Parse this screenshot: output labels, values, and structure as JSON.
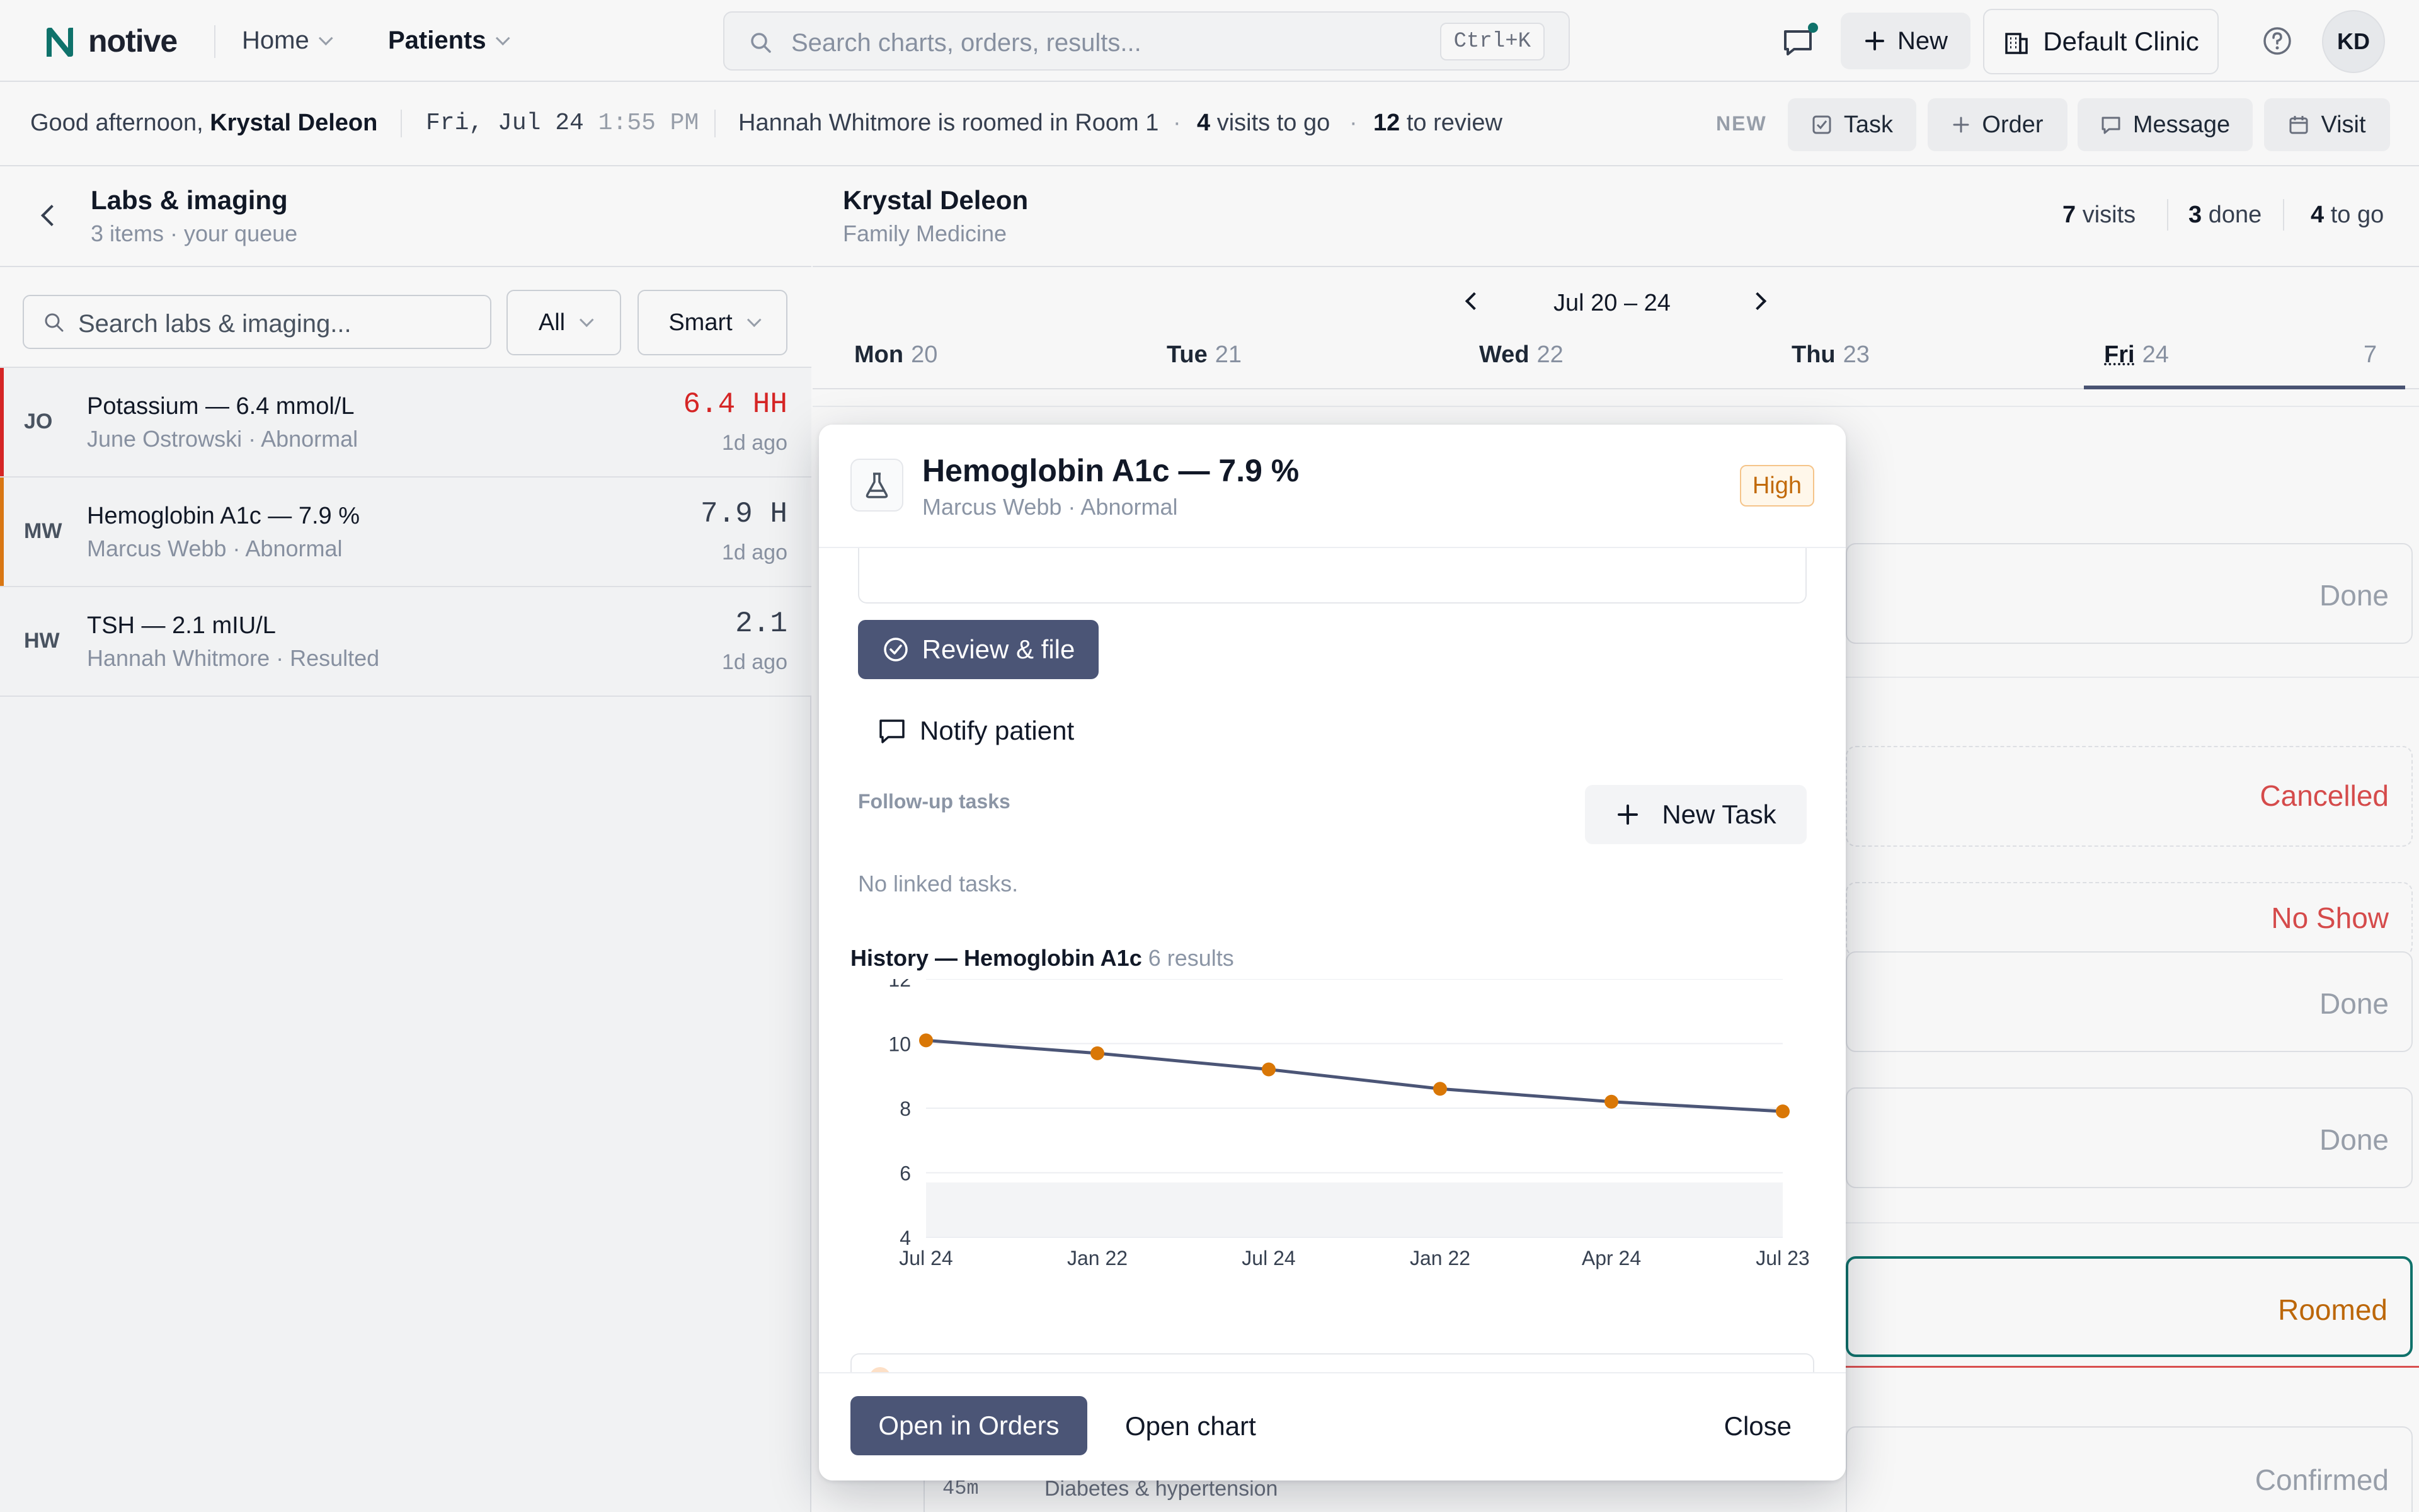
{
  "app": {
    "name": "notive",
    "nav": [
      {
        "label": "Home"
      },
      {
        "label": "Patients"
      }
    ],
    "search": {
      "placeholder": "Search charts, orders, results...",
      "shortcut": "Ctrl+K"
    },
    "new_label": "New",
    "clinic_label": "Default Clinic",
    "user_initials": "KD"
  },
  "status": {
    "greeting": "Good afternoon,",
    "user_name": "Krystal Deleon",
    "date": "Fri, Jul 24",
    "time": "1:55 PM",
    "roomed": "Hannah Whitmore is roomed in Room 1",
    "visits_count": "4",
    "visits_text": "visits to go",
    "review_count": "12",
    "review_text": "to review",
    "new_label": "NEW",
    "actions": [
      {
        "label": "Task",
        "icon": "task-icon"
      },
      {
        "label": "Order",
        "icon": "plus-icon"
      },
      {
        "label": "Message",
        "icon": "message-icon"
      },
      {
        "label": "Visit",
        "icon": "calendar-icon"
      }
    ]
  },
  "left_panel": {
    "title": "Labs & imaging",
    "subtitle": "3 items · your queue",
    "search_placeholder": "Search labs & imaging...",
    "filter_all": "All",
    "filter_smart": "Smart",
    "items": [
      {
        "initials": "JO",
        "name": "Potassium — 6.4 mmol/L",
        "sub": "June Ostrowski · Abnormal",
        "value": "6.4 HH",
        "ago": "1d ago",
        "flag_color": "#dc2626",
        "value_color": "#dc2626"
      },
      {
        "initials": "MW",
        "name": "Hemoglobin A1c — 7.9 %",
        "sub": "Marcus Webb · Abnormal",
        "value": "7.9 H",
        "ago": "1d ago",
        "flag_color": "#e07b13",
        "value_color": "#374151"
      },
      {
        "initials": "HW",
        "name": "TSH — 2.1 mIU/L",
        "sub": "Hannah Whitmore · Resulted",
        "value": "2.1",
        "ago": "1d ago",
        "flag_color": "transparent",
        "value_color": "#374151"
      }
    ]
  },
  "main": {
    "provider_name": "Krystal Deleon",
    "specialty": "Family Medicine",
    "stats": [
      {
        "num": "7",
        "label": "visits"
      },
      {
        "num": "3",
        "label": "done"
      },
      {
        "num": "4",
        "label": "to go"
      }
    ],
    "week_range": "Jul 20 – 24",
    "days": [
      {
        "name": "Mon",
        "num": "20"
      },
      {
        "name": "Tue",
        "num": "21"
      },
      {
        "name": "Wed",
        "num": "22"
      },
      {
        "name": "Thu",
        "num": "23"
      },
      {
        "name": "Fri",
        "num": "24"
      }
    ],
    "fri_count": "7",
    "visit_statuses": [
      {
        "label": "Done",
        "color": "#9ca3af"
      },
      {
        "label": "Cancelled",
        "color": "#dc4d4d"
      },
      {
        "label": "No Show",
        "color": "#dc4d4d"
      },
      {
        "label": "Done",
        "color": "#9ca3af"
      },
      {
        "label": "Done",
        "color": "#9ca3af"
      },
      {
        "label": "Roomed",
        "color": "#c26a0a"
      },
      {
        "label": "Confirmed",
        "color": "#9ca3af"
      }
    ],
    "visit_duration": "45m",
    "visit_reason": "Diabetes & hypertension"
  },
  "modal": {
    "title": "Hemoglobin A1c — 7.9 %",
    "subtitle": "Marcus Webb · Abnormal",
    "badge": "High",
    "review_label": "Review & file",
    "notify_label": "Notify patient",
    "followup_label": "Follow-up tasks",
    "new_task_label": "New Task",
    "no_linked": "No linked tasks.",
    "history_title": "History — Hemoglobin A1c",
    "history_count": "6 results",
    "open_orders_label": "Open in Orders",
    "open_chart_label": "Open chart",
    "close_label": "Close"
  },
  "chart_data": {
    "type": "line",
    "title": "History — Hemoglobin A1c",
    "categories": [
      "Jul 24",
      "Jan 22",
      "Jul 24",
      "Jan 22",
      "Apr 24",
      "Jul 23"
    ],
    "values": [
      10.1,
      9.7,
      9.2,
      8.6,
      8.2,
      7.9
    ],
    "ylim": [
      4,
      12
    ],
    "yticks": [
      4,
      6,
      8,
      10,
      12
    ],
    "reference_range": [
      4,
      5.7
    ],
    "line_color": "#4b5576",
    "point_color": "#d97706",
    "grid": true
  }
}
